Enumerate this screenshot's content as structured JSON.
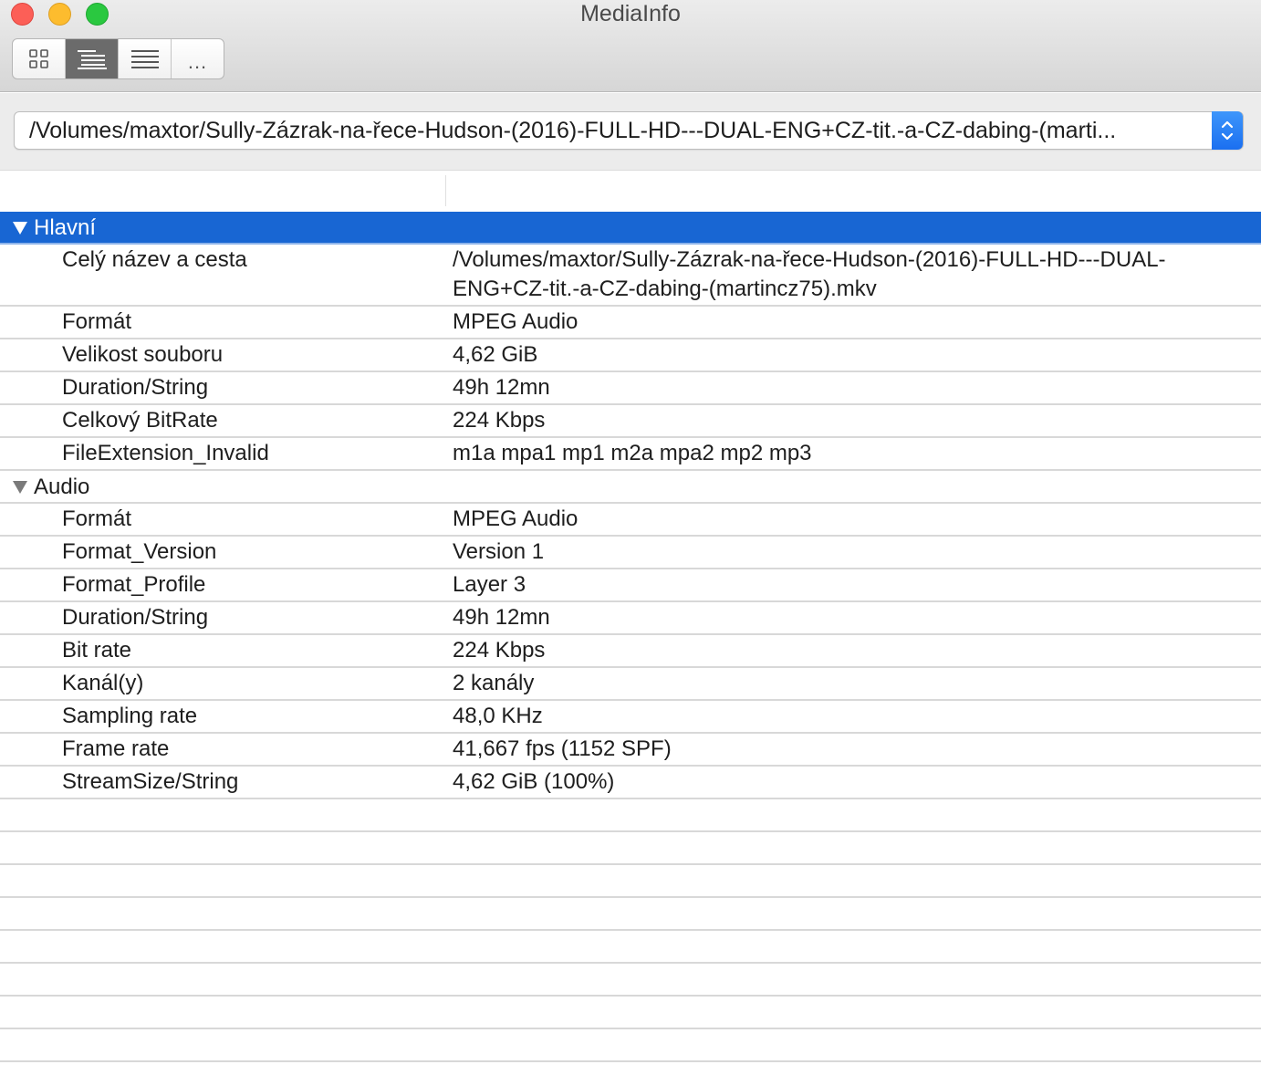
{
  "window": {
    "title": "MediaInfo"
  },
  "toolbar": {
    "view_buttons": [
      {
        "name": "basic-view",
        "icon": "grid-icon",
        "active": false
      },
      {
        "name": "tree-view",
        "icon": "tree-list-icon",
        "active": true
      },
      {
        "name": "text-view",
        "icon": "text-lines-icon",
        "active": false
      },
      {
        "name": "more",
        "icon": "ellipsis-icon",
        "label": "...",
        "active": false
      }
    ]
  },
  "file_select": {
    "value": "/Volumes/maxtor/Sully-Zázrak-na-řece-Hudson-(2016)-FULL-HD---DUAL-ENG+CZ-tit.-a-CZ-dabing-(marti..."
  },
  "sections": [
    {
      "title": "Hlavní",
      "selected": true,
      "rows": [
        {
          "label": "Celý název a cesta",
          "value": "/Volumes/maxtor/Sully-Zázrak-na-řece-Hudson-(2016)-FULL-HD---DUAL-ENG+CZ-tit.-a-CZ-dabing-(martincz75).mkv",
          "tall": true
        },
        {
          "label": "Formát",
          "value": "MPEG Audio"
        },
        {
          "label": "Velikost souboru",
          "value": "4,62 GiB"
        },
        {
          "label": "Duration/String",
          "value": "49h 12mn"
        },
        {
          "label": "Celkový BitRate",
          "value": "224 Kbps"
        },
        {
          "label": "FileExtension_Invalid",
          "value": "m1a mpa1 mp1 m2a mpa2 mp2 mp3"
        }
      ]
    },
    {
      "title": "Audio",
      "selected": false,
      "rows": [
        {
          "label": "Formát",
          "value": "MPEG Audio"
        },
        {
          "label": "Format_Version",
          "value": "Version 1"
        },
        {
          "label": "Format_Profile",
          "value": "Layer 3"
        },
        {
          "label": "Duration/String",
          "value": "49h 12mn"
        },
        {
          "label": "Bit rate",
          "value": "224 Kbps"
        },
        {
          "label": "Kanál(y)",
          "value": "2 kanály"
        },
        {
          "label": "Sampling rate",
          "value": "48,0 KHz"
        },
        {
          "label": "Frame rate",
          "value": "41,667 fps (1152 SPF)"
        },
        {
          "label": "StreamSize/String",
          "value": "4,62 GiB (100%)"
        }
      ]
    }
  ],
  "colors": {
    "selection": "#1866d3",
    "close": "#fc5f57",
    "minimize": "#fdbc2e",
    "zoom": "#2ac840",
    "stepper": "#2a7ff6"
  }
}
